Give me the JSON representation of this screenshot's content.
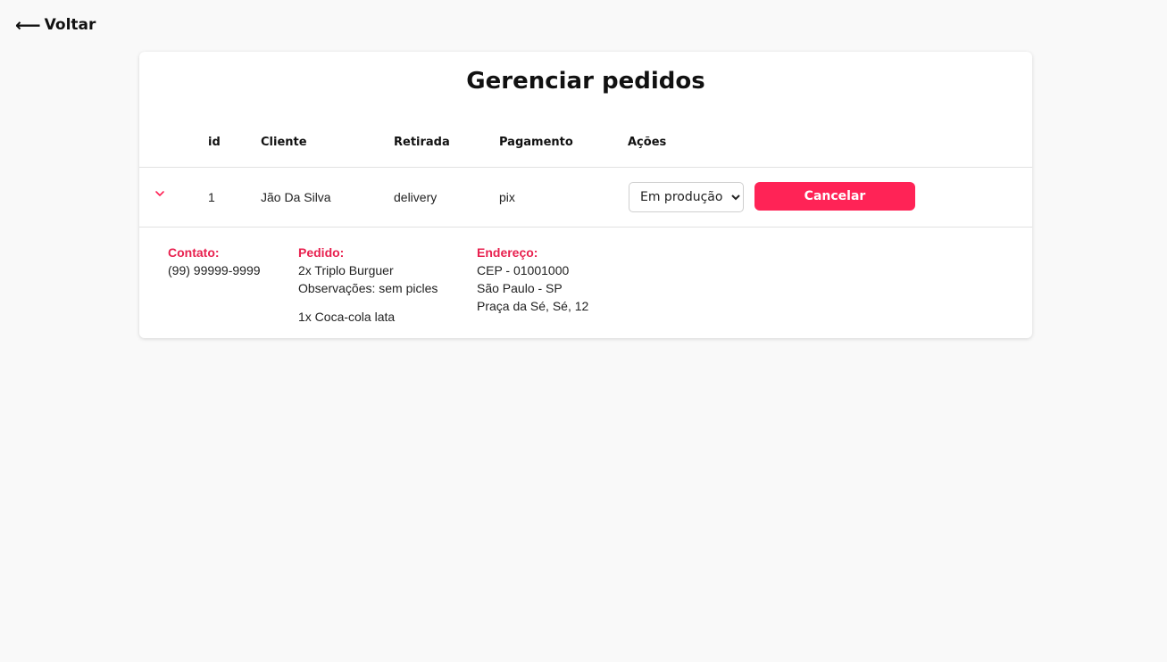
{
  "nav": {
    "back_label": "Voltar",
    "back_arrow": "⟵"
  },
  "page": {
    "title": "Gerenciar pedidos"
  },
  "table": {
    "headers": {
      "id": "id",
      "client": "Cliente",
      "pickup": "Retirada",
      "payment": "Pagamento",
      "actions": "Ações"
    },
    "rows": [
      {
        "id": "1",
        "client": "Jão Da Silva",
        "pickup": "delivery",
        "payment": "pix",
        "status_selected": "Em produção",
        "cancel_label": "Cancelar",
        "details": {
          "contact_label": "Contato:",
          "contact_value": "(99) 99999-9999",
          "order_label": "Pedido:",
          "order_item_1": "2x Triplo Burguer",
          "order_item_1_notes": "Observações: sem picles",
          "order_item_2": "1x Coca-cola lata",
          "address_label": "Endereço:",
          "address_cep": "CEP - 01001000",
          "address_city": "São Paulo - SP",
          "address_street": "Praça da Sé, Sé, 12"
        }
      }
    ]
  },
  "colors": {
    "accent": "#ff2356",
    "detail_label": "#e8214f",
    "background": "#f9f9f9"
  },
  "icons": {
    "expand": "chevron-down-icon",
    "back": "arrow-left-icon"
  }
}
